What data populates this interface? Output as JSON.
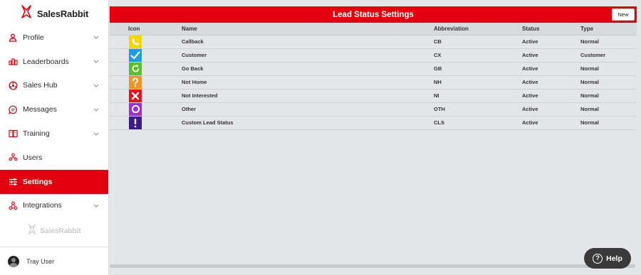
{
  "brand": {
    "name": "SalesRabbit",
    "color": "#e2000f"
  },
  "sidebar": {
    "items": [
      {
        "label": "Profile",
        "icon": "user-icon",
        "has_chevron": true,
        "active": false
      },
      {
        "label": "Leaderboards",
        "icon": "leaderboard-icon",
        "has_chevron": true,
        "active": false
      },
      {
        "label": "Sales Hub",
        "icon": "sales-hub-icon",
        "has_chevron": true,
        "active": false
      },
      {
        "label": "Messages",
        "icon": "message-icon",
        "has_chevron": true,
        "active": false
      },
      {
        "label": "Training",
        "icon": "training-icon",
        "has_chevron": true,
        "active": false
      },
      {
        "label": "Users",
        "icon": "users-icon",
        "has_chevron": false,
        "active": false
      },
      {
        "label": "Settings",
        "icon": "settings-sliders-icon",
        "has_chevron": false,
        "active": true
      },
      {
        "label": "Integrations",
        "icon": "integrations-icon",
        "has_chevron": true,
        "active": false
      }
    ],
    "footer_logo": "SalesRabbit",
    "user": {
      "name": "Tray User"
    }
  },
  "main": {
    "title": "Lead Status Settings",
    "new_label": "New",
    "columns": [
      "Icon",
      "Name",
      "Abbreviation",
      "Status",
      "Type"
    ],
    "rows": [
      {
        "icon": "phone-icon",
        "color": "#f7d600",
        "name": "Callback",
        "abbreviation": "CB",
        "status": "Active",
        "type": "Normal"
      },
      {
        "icon": "checkmark-icon",
        "color": "#1a9fe0",
        "name": "Customer",
        "abbreviation": "CX",
        "status": "Active",
        "type": "Customer"
      },
      {
        "icon": "refresh-icon",
        "color": "#5bbf2a",
        "name": "Go Back",
        "abbreviation": "GB",
        "status": "Active",
        "type": "Normal"
      },
      {
        "icon": "question-mark-icon",
        "color": "#f7941d",
        "name": "Not Home",
        "abbreviation": "NH",
        "status": "Active",
        "type": "Normal"
      },
      {
        "icon": "x-icon",
        "color": "#e8101a",
        "name": "Not Interested",
        "abbreviation": "NI",
        "status": "Active",
        "type": "Normal"
      },
      {
        "icon": "circle-icon",
        "color": "#9a2fd6",
        "name": "Other",
        "abbreviation": "OTH",
        "status": "Active",
        "type": "Normal"
      },
      {
        "icon": "exclamation-icon",
        "color": "#3b1a8a",
        "name": "Custom Lead Status",
        "abbreviation": "CLS",
        "status": "Active",
        "type": "Normal"
      }
    ]
  },
  "help": {
    "label": "Help"
  }
}
